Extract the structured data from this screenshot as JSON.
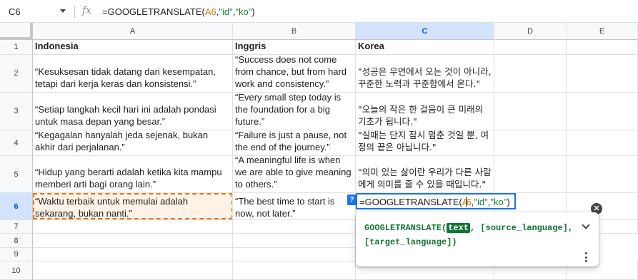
{
  "namebox": {
    "value": "C6"
  },
  "formula_bar": {
    "prefix": "=GOOGLETRANSLATE(",
    "ref": "A6",
    "comma1": ",",
    "arg2": "\"id\"",
    "comma2": ",",
    "arg3": "\"ko\"",
    "suffix": ")"
  },
  "columns": [
    "A",
    "B",
    "C",
    "D",
    "E"
  ],
  "rows": [
    "1",
    "2",
    "3",
    "4",
    "5",
    "6",
    "7",
    "8",
    "9",
    "10"
  ],
  "headers": {
    "a": "Indonesia",
    "b": "Inggris",
    "c": "Korea"
  },
  "data_rows": [
    {
      "a": "“Kesuksesan tidak datang dari kesempatan, tetapi dari kerja keras dan konsistensi.”",
      "b": "“Success does not come from chance, but from hard work and consistency.”",
      "c": "\"성공은 우연에서 오는 것이 아니라, 꾸준한 노력과 꾸준함에서 온다.\""
    },
    {
      "a": "“Setiap langkah kecil hari ini adalah pondasi untuk masa depan yang besar.”",
      "b": "“Every small step today is the foundation for a big future.”",
      "c": "\"오늘의 작은 한 걸음이 큰 미래의 기초가 됩니다.\""
    },
    {
      "a": "“Kegagalan hanyalah jeda sejenak, bukan akhir dari perjalanan.”",
      "b": "“Failure is just a pause, not the end of the journey.”",
      "c": "\"실패는 단지 잠시 멈춘 것일 뿐, 여정의 끝은 아닙니다.\""
    },
    {
      "a": "“Hidup yang berarti adalah ketika kita mampu memberi arti bagi orang lain.”",
      "b": "“A meaningful life is when we are able to give meaning to others.”",
      "c": "\"의미 있는 삶이란 우리가 다른 사람에게 의미를 줄 수 있을 때입니다.\""
    },
    {
      "a": "“Waktu terbaik untuk memulai adalah sekarang, bukan nanti.”",
      "b": "“The best time to start is now, not later.”",
      "c": ""
    }
  ],
  "editor": {
    "prefix": "=GOOGLETRANSLATE(",
    "ref_a": "A",
    "ref_b": "6",
    "rest1": ",",
    "arg2": "\"id\"",
    "rest2": ",",
    "arg3": "\"ko\"",
    "suffix": ")"
  },
  "tooltip": {
    "fn": "GOOGLETRANSLATE(",
    "param_current": "text",
    "rest_line1": ", [source_language],",
    "rest_line2": "[target_language])"
  },
  "icons": {
    "namebox_caret": "chevron-down-icon",
    "fx": "function-icon",
    "help": "help-icon",
    "close": "close-icon",
    "expand": "chevron-down-icon",
    "more": "more-vert-icon"
  },
  "colors": {
    "selection_blue": "#1a73e8",
    "copy_orange": "#e8710a",
    "ref_orange": "#e37400",
    "string_green": "#188038",
    "header_active": "#d3e3fd"
  }
}
